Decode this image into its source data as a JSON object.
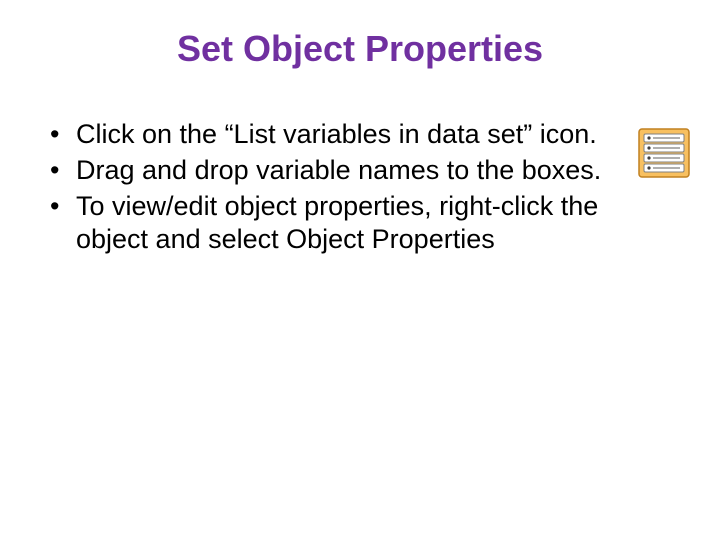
{
  "title": "Set Object Properties",
  "bullets": {
    "item0": "Click on the “List variables in data set” icon.",
    "item1": "Drag and drop variable names to the boxes.",
    "item2": "To view/edit object properties, right-click the object and select Object Properties"
  },
  "icon_name": "variable-list-icon"
}
